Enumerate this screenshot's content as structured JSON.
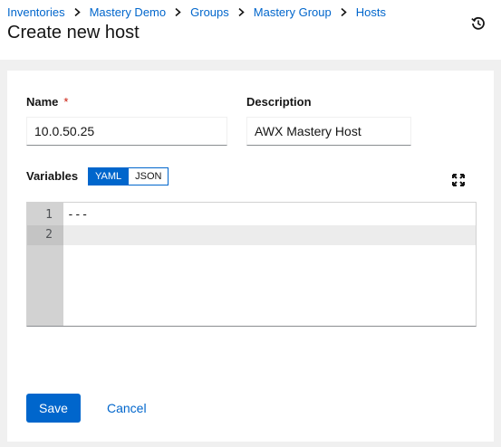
{
  "breadcrumb": {
    "items": [
      "Inventories",
      "Mastery Demo",
      "Groups",
      "Mastery Group",
      "Hosts"
    ]
  },
  "page": {
    "title": "Create new host"
  },
  "header": {
    "history_icon": "history-icon"
  },
  "form": {
    "name": {
      "label": "Name",
      "required_mark": "*",
      "value": "10.0.50.25"
    },
    "description": {
      "label": "Description",
      "value": "AWX Mastery Host"
    },
    "variables": {
      "label": "Variables",
      "modes": [
        "YAML",
        "JSON"
      ],
      "selected_mode": "YAML",
      "expand_icon": "expand-icon",
      "editor_lines": [
        {
          "number": "1",
          "text": "---"
        },
        {
          "number": "2",
          "text": ""
        }
      ]
    }
  },
  "actions": {
    "save_label": "Save",
    "cancel_label": "Cancel"
  },
  "colors": {
    "primary": "#0066cc",
    "required": "#c9190b",
    "gutter": "#d2d2d2"
  }
}
